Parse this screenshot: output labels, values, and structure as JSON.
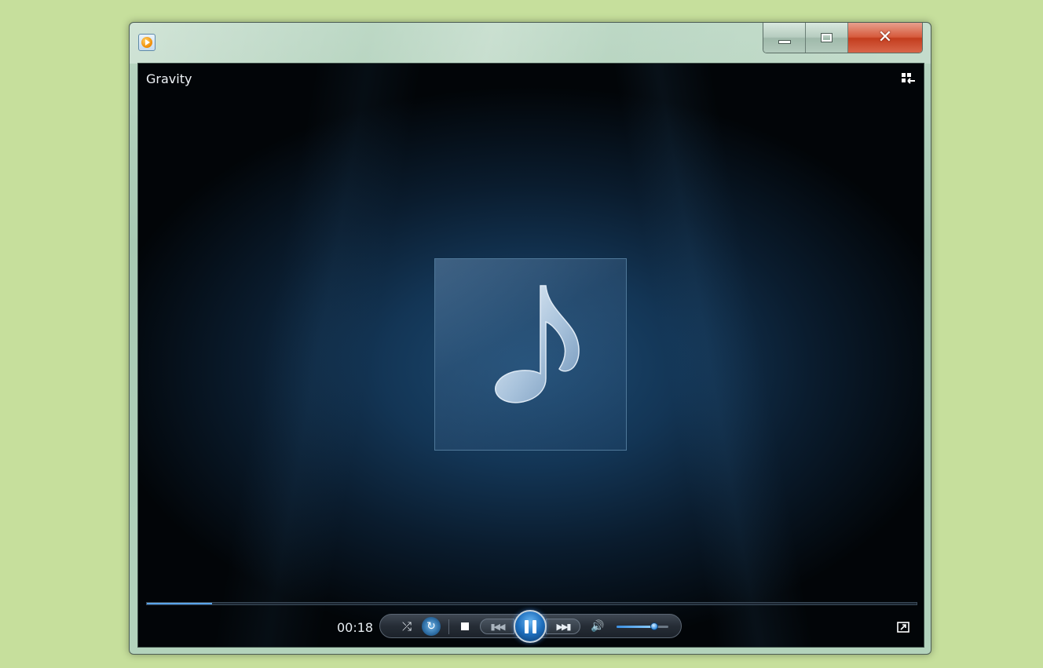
{
  "window": {
    "app_icon": "media-player-icon",
    "caption": {
      "minimize_icon": "minimize-icon",
      "maximize_icon": "maximize-icon",
      "close_icon": "close-icon",
      "close_color": "#d04a2a"
    }
  },
  "now_playing": {
    "title": "Gravity",
    "time": "00:18",
    "progress_fraction": 0.085,
    "album_art_icon": "music-note-icon",
    "switch_to_library_icon": "switch-to-library-icon"
  },
  "controls": {
    "shuffle_icon": "shuffle-icon",
    "repeat_icon": "repeat-icon",
    "repeat_active": true,
    "stop_icon": "stop-icon",
    "previous_icon": "previous-icon",
    "play_pause_icon": "pause-icon",
    "next_icon": "next-icon",
    "mute_icon": "speaker-icon",
    "volume_fraction": 0.72,
    "fullscreen_icon": "fullscreen-icon",
    "accent_color": "#2e7fd0"
  }
}
